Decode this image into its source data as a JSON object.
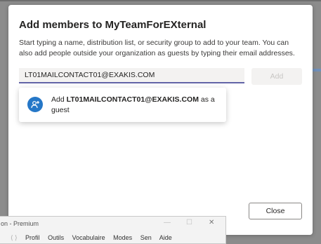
{
  "dialog": {
    "title": "Add members to MyTeamForEXternal",
    "description": "Start typing a name, distribution list, or security group to add to your team. You can also add people outside your organization as guests by typing their email addresses.",
    "input_value": "LT01MAILCONTACT01@EXAKIS.COM",
    "add_label": "Add",
    "suggestion": {
      "prefix": "Add ",
      "email": "LT01MAILCONTACT01@EXAKIS.COM",
      "suffix": " as a guest",
      "icon": "guest-person-icon"
    },
    "close_label": "Close"
  },
  "background_window": {
    "title": "on - Premium",
    "minimize": "—",
    "maximize": "☐",
    "close": "✕",
    "menu": [
      "Profil",
      "Outils",
      "Vocabulaire",
      "Modes",
      "Sen",
      "Aide"
    ]
  },
  "colors": {
    "accent": "#6264a7",
    "icon_bg": "#2577c7",
    "overlay": "#8c8c8c"
  }
}
